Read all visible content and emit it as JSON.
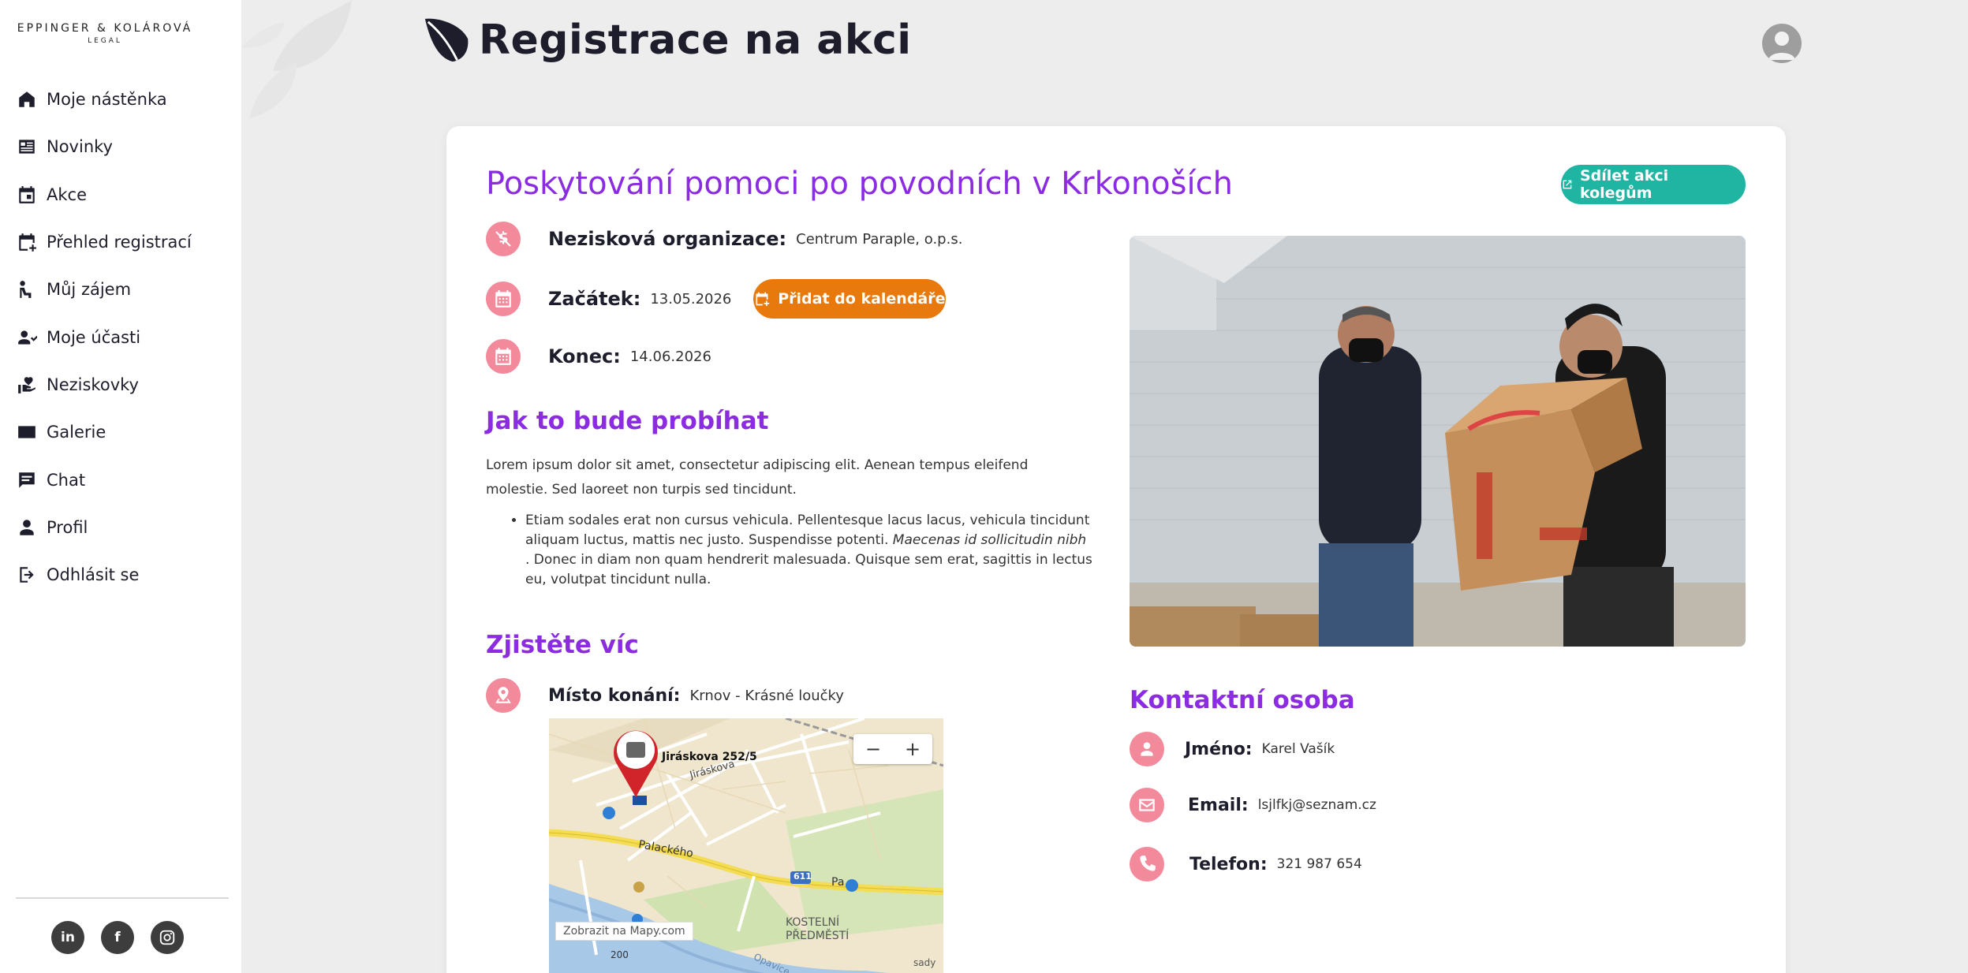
{
  "brand": {
    "line1": "EPPINGER & KOLÁROVÁ",
    "line2": "LEGAL"
  },
  "sidebar": {
    "items": [
      {
        "label": "Moje nástěnka",
        "icon": "home-icon"
      },
      {
        "label": "Novinky",
        "icon": "news-icon"
      },
      {
        "label": "Akce",
        "icon": "calendar-icon"
      },
      {
        "label": "Přehled registrací",
        "icon": "calendar-add-icon"
      },
      {
        "label": "Můj zájem",
        "icon": "interest-icon"
      },
      {
        "label": "Moje účasti",
        "icon": "person-check-icon"
      },
      {
        "label": "Neziskovky",
        "icon": "volunteer-hands-icon"
      },
      {
        "label": "Galerie",
        "icon": "gallery-icon"
      },
      {
        "label": "Chat",
        "icon": "chat-icon"
      },
      {
        "label": "Profil",
        "icon": "person-icon"
      },
      {
        "label": "Odhlásit se",
        "icon": "logout-icon"
      }
    ],
    "socials": [
      "in",
      "f",
      "ig"
    ]
  },
  "header": {
    "title": "Registrace na akci"
  },
  "event": {
    "title": "Poskytování pomoci po povodních v Krkonoších",
    "share_label": "Sdílet akci kolegům",
    "org_label": "Nezisková organizace:",
    "org_value": "Centrum Paraple, o.p.s.",
    "start_label": "Začátek:",
    "start_value": "13.05.2026",
    "calendar_btn": "Přidat do kalendáře",
    "end_label": "Konec:",
    "end_value": "14.06.2026",
    "how_heading": "Jak to bude probíhat",
    "description": "Lorem ipsum dolor sit amet, consectetur adipiscing elit. Aenean tempus eleifend molestie. Sed laoreet non turpis sed tincidunt.",
    "bullet_text_1": "Etiam sodales erat non cursus vehicula. Pellentesque lacus lacus, vehicula tincidunt aliquam luctus, mattis nec justo. Suspendisse potenti. ",
    "bullet_italic": "Maecenas id sollicitudin nibh",
    "bullet_text_2": " . Donec in diam non quam hendrerit malesuada. Quisque sem erat, sagittis in lectus eu, volutpat tincidunt nulla.",
    "more_heading": "Zjistěte víc",
    "place_label": "Místo konání:",
    "place_value": "Krnov - Krásné loučky"
  },
  "map": {
    "address": "Jiráskova 252/5",
    "street_a": "Jiráskova",
    "street_b": "Palackého",
    "street_c": "Pa",
    "road_number": "611",
    "district_1": "KOSTELNÍ",
    "district_2": "PŘEDMĚSTÍ",
    "link": "Zobrazit na Mapy.com",
    "zoom_out": "−",
    "zoom_in": "+",
    "scale": "200",
    "river": "Opavice",
    "corner": "sady"
  },
  "contact": {
    "heading": "Kontaktní osoba",
    "name_label": "Jméno:",
    "name_value": "Karel Vašík",
    "email_label": "Email:",
    "email_value": "lsjlfkj@seznam.cz",
    "phone_label": "Telefon:",
    "phone_value": "321 987 654"
  },
  "colors": {
    "accent_purple": "#8b2be2",
    "teal": "#1fb5a2",
    "orange": "#e8790d",
    "pink_icon": "#f28a9b"
  }
}
